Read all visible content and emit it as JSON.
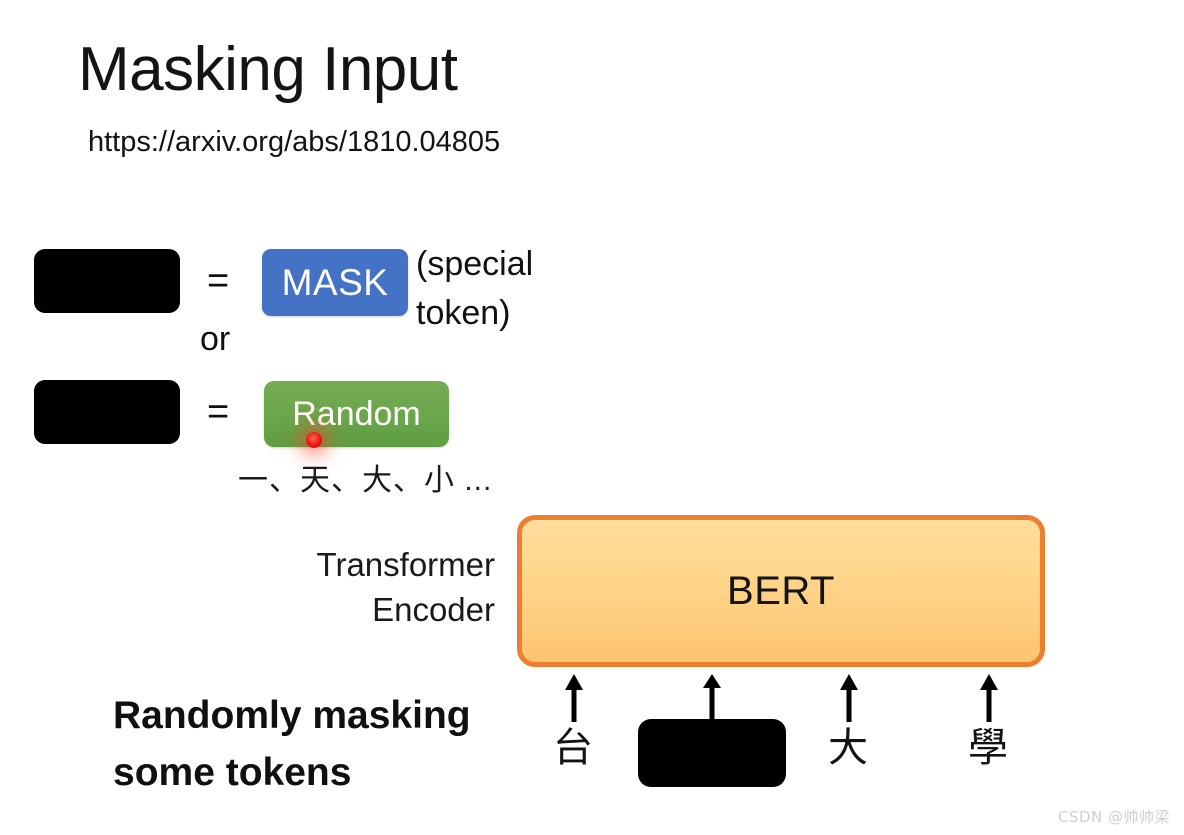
{
  "slide": {
    "title": "Masking Input",
    "subtitle_url": "https://arxiv.org/abs/1810.04805",
    "background_color": "#ffffff"
  },
  "legend": {
    "equals_symbol": "=",
    "or_label": "or",
    "mask_chip": {
      "label": "MASK",
      "color": "#4472c4",
      "text_color": "#ffffff"
    },
    "mask_note": "(special\ntoken)",
    "random_chip": {
      "label": "Random",
      "color": "#6aa64b",
      "text_color": "#ffffff"
    },
    "random_examples": "一、天、大、小 ...",
    "laser_pointer": {
      "name": "laser-pointer-dot",
      "color": "#ee1c1c"
    }
  },
  "model": {
    "encoder_caption": "Transformer\nEncoder",
    "box_label": "BERT",
    "box_fill_color": "#ffd48a",
    "box_border_color": "#ed7d31"
  },
  "inputs": {
    "tokens": [
      {
        "text": "台",
        "masked": false
      },
      {
        "text": "",
        "masked": true
      },
      {
        "text": "大",
        "masked": false
      },
      {
        "text": "學",
        "masked": false
      }
    ],
    "arrow_count": 4
  },
  "caption": {
    "text": "Randomly masking\nsome tokens"
  },
  "watermark": {
    "text": "CSDN @帅帅梁"
  }
}
